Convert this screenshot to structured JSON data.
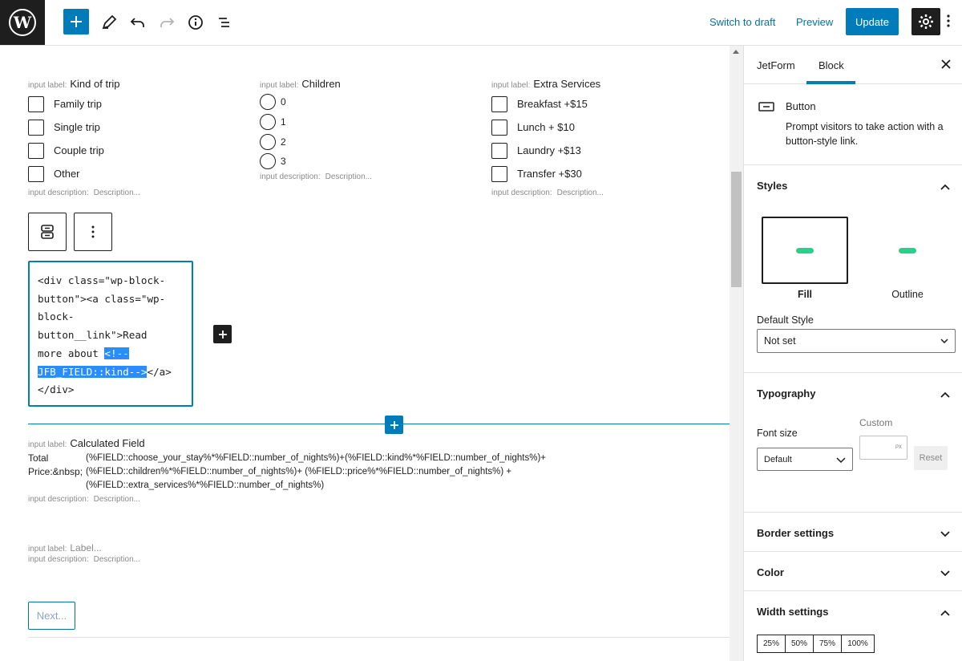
{
  "topbar": {
    "switch_to_draft": "Switch to draft",
    "preview": "Preview",
    "update": "Update"
  },
  "form": {
    "label_prefix": "input label:",
    "desc_prefix": "input description:",
    "desc_placeholder": "Description...",
    "kind_of_trip": {
      "label": "Kind of trip",
      "options": [
        "Family trip",
        "Single trip",
        "Couple trip",
        "Other"
      ]
    },
    "children": {
      "label": "Children",
      "options": [
        "0",
        "1",
        "2",
        "3"
      ]
    },
    "extra_services": {
      "label": "Extra Services",
      "options": [
        "Breakfast +$15",
        "Lunch + $10",
        "Laundry +$13",
        "Transfer +$30"
      ]
    },
    "html_block": {
      "line1": "<div class=\"wp-block-",
      "line2": "button\"><a class=\"wp-",
      "line3": "block-",
      "line4": "button__link\">Read",
      "line5_plain": "more about ",
      "line5_sel": "<!--",
      "line6_sel": "JFB_FIELD::kind-->",
      "line6_plain": "</a>",
      "line7": "</div>"
    },
    "calculated": {
      "label": "Calculated Field",
      "name_line1": "Total",
      "name_line2": "Price:&nbsp;",
      "formula_line1": "(%FIELD::choose_your_stay%*%FIELD::number_of_nights%)+(%FIELD::kind%*%FIELD::number_of_nights%)+",
      "formula_line2": "(%FIELD::children%*%FIELD::number_of_nights%)+ (%FIELD::price%*%FIELD::number_of_nights%) +",
      "formula_line3": "(%FIELD::extra_services%*%FIELD::number_of_nights%)"
    },
    "empty_label_placeholder": "Label...",
    "next_button": "Next..."
  },
  "sidebar": {
    "tabs": [
      "JetForm",
      "Block"
    ],
    "active_tab": "Block",
    "block_name": "Button",
    "block_desc": "Prompt visitors to take action with a button-style link.",
    "styles_title": "Styles",
    "style_fill": "Fill",
    "style_outline": "Outline",
    "default_style_label": "Default Style",
    "default_style_value": "Not set",
    "typography_title": "Typography",
    "font_size_label": "Font size",
    "custom_label": "Custom",
    "custom_unit": "PX",
    "font_size_value": "Default",
    "reset": "Reset",
    "border_settings": "Border settings",
    "color": "Color",
    "width_settings": "Width settings",
    "width_options": [
      "25%",
      "50%",
      "75%",
      "100%"
    ],
    "accent_color": "#2bce8a"
  }
}
